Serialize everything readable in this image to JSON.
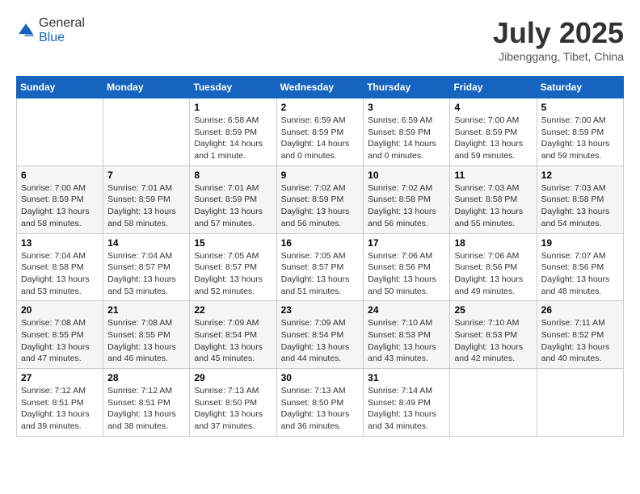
{
  "header": {
    "logo_general": "General",
    "logo_blue": "Blue",
    "month": "July 2025",
    "location": "Jibenggang, Tibet, China"
  },
  "weekdays": [
    "Sunday",
    "Monday",
    "Tuesday",
    "Wednesday",
    "Thursday",
    "Friday",
    "Saturday"
  ],
  "weeks": [
    [
      {
        "day": "",
        "detail": ""
      },
      {
        "day": "",
        "detail": ""
      },
      {
        "day": "1",
        "detail": "Sunrise: 6:58 AM\nSunset: 8:59 PM\nDaylight: 14 hours and 1 minute."
      },
      {
        "day": "2",
        "detail": "Sunrise: 6:59 AM\nSunset: 8:59 PM\nDaylight: 14 hours and 0 minutes."
      },
      {
        "day": "3",
        "detail": "Sunrise: 6:59 AM\nSunset: 8:59 PM\nDaylight: 14 hours and 0 minutes."
      },
      {
        "day": "4",
        "detail": "Sunrise: 7:00 AM\nSunset: 8:59 PM\nDaylight: 13 hours and 59 minutes."
      },
      {
        "day": "5",
        "detail": "Sunrise: 7:00 AM\nSunset: 8:59 PM\nDaylight: 13 hours and 59 minutes."
      }
    ],
    [
      {
        "day": "6",
        "detail": "Sunrise: 7:00 AM\nSunset: 8:59 PM\nDaylight: 13 hours and 58 minutes."
      },
      {
        "day": "7",
        "detail": "Sunrise: 7:01 AM\nSunset: 8:59 PM\nDaylight: 13 hours and 58 minutes."
      },
      {
        "day": "8",
        "detail": "Sunrise: 7:01 AM\nSunset: 8:59 PM\nDaylight: 13 hours and 57 minutes."
      },
      {
        "day": "9",
        "detail": "Sunrise: 7:02 AM\nSunset: 8:59 PM\nDaylight: 13 hours and 56 minutes."
      },
      {
        "day": "10",
        "detail": "Sunrise: 7:02 AM\nSunset: 8:58 PM\nDaylight: 13 hours and 56 minutes."
      },
      {
        "day": "11",
        "detail": "Sunrise: 7:03 AM\nSunset: 8:58 PM\nDaylight: 13 hours and 55 minutes."
      },
      {
        "day": "12",
        "detail": "Sunrise: 7:03 AM\nSunset: 8:58 PM\nDaylight: 13 hours and 54 minutes."
      }
    ],
    [
      {
        "day": "13",
        "detail": "Sunrise: 7:04 AM\nSunset: 8:58 PM\nDaylight: 13 hours and 53 minutes."
      },
      {
        "day": "14",
        "detail": "Sunrise: 7:04 AM\nSunset: 8:57 PM\nDaylight: 13 hours and 53 minutes."
      },
      {
        "day": "15",
        "detail": "Sunrise: 7:05 AM\nSunset: 8:57 PM\nDaylight: 13 hours and 52 minutes."
      },
      {
        "day": "16",
        "detail": "Sunrise: 7:05 AM\nSunset: 8:57 PM\nDaylight: 13 hours and 51 minutes."
      },
      {
        "day": "17",
        "detail": "Sunrise: 7:06 AM\nSunset: 8:56 PM\nDaylight: 13 hours and 50 minutes."
      },
      {
        "day": "18",
        "detail": "Sunrise: 7:06 AM\nSunset: 8:56 PM\nDaylight: 13 hours and 49 minutes."
      },
      {
        "day": "19",
        "detail": "Sunrise: 7:07 AM\nSunset: 8:56 PM\nDaylight: 13 hours and 48 minutes."
      }
    ],
    [
      {
        "day": "20",
        "detail": "Sunrise: 7:08 AM\nSunset: 8:55 PM\nDaylight: 13 hours and 47 minutes."
      },
      {
        "day": "21",
        "detail": "Sunrise: 7:08 AM\nSunset: 8:55 PM\nDaylight: 13 hours and 46 minutes."
      },
      {
        "day": "22",
        "detail": "Sunrise: 7:09 AM\nSunset: 8:54 PM\nDaylight: 13 hours and 45 minutes."
      },
      {
        "day": "23",
        "detail": "Sunrise: 7:09 AM\nSunset: 8:54 PM\nDaylight: 13 hours and 44 minutes."
      },
      {
        "day": "24",
        "detail": "Sunrise: 7:10 AM\nSunset: 8:53 PM\nDaylight: 13 hours and 43 minutes."
      },
      {
        "day": "25",
        "detail": "Sunrise: 7:10 AM\nSunset: 8:53 PM\nDaylight: 13 hours and 42 minutes."
      },
      {
        "day": "26",
        "detail": "Sunrise: 7:11 AM\nSunset: 8:52 PM\nDaylight: 13 hours and 40 minutes."
      }
    ],
    [
      {
        "day": "27",
        "detail": "Sunrise: 7:12 AM\nSunset: 8:51 PM\nDaylight: 13 hours and 39 minutes."
      },
      {
        "day": "28",
        "detail": "Sunrise: 7:12 AM\nSunset: 8:51 PM\nDaylight: 13 hours and 38 minutes."
      },
      {
        "day": "29",
        "detail": "Sunrise: 7:13 AM\nSunset: 8:50 PM\nDaylight: 13 hours and 37 minutes."
      },
      {
        "day": "30",
        "detail": "Sunrise: 7:13 AM\nSunset: 8:50 PM\nDaylight: 13 hours and 36 minutes."
      },
      {
        "day": "31",
        "detail": "Sunrise: 7:14 AM\nSunset: 8:49 PM\nDaylight: 13 hours and 34 minutes."
      },
      {
        "day": "",
        "detail": ""
      },
      {
        "day": "",
        "detail": ""
      }
    ]
  ]
}
